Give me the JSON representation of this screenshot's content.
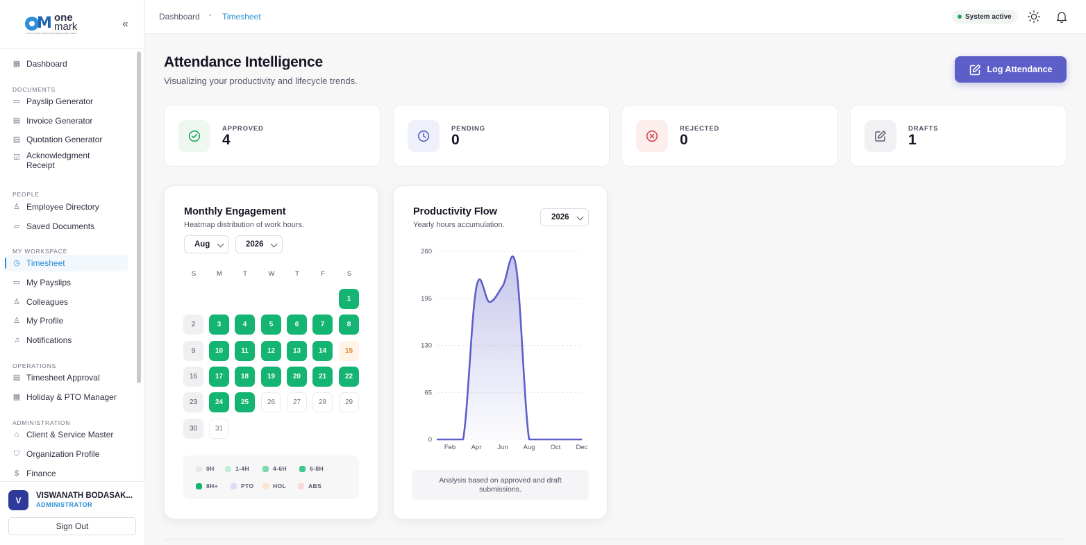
{
  "brand": {
    "name_top": "one",
    "name_bottom": "mark",
    "tagline": "A unit of Amarg Creative Technologies Private Limited"
  },
  "nav": {
    "collapse_label": "«",
    "items": [
      {
        "label": "Dashboard",
        "icon": "grid-icon"
      },
      {
        "section": "DOCUMENTS"
      },
      {
        "label": "Payslip Generator",
        "icon": "card-icon"
      },
      {
        "label": "Invoice Generator",
        "icon": "document-icon"
      },
      {
        "label": "Quotation Generator",
        "icon": "document-icon"
      },
      {
        "label": "Acknowledgment Receipt",
        "icon": "check-square-icon"
      },
      {
        "section": "PEOPLE"
      },
      {
        "label": "Employee Directory",
        "icon": "users-icon"
      },
      {
        "label": "Saved Documents",
        "icon": "folder-icon"
      },
      {
        "section": "MY WORKSPACE"
      },
      {
        "label": "Timesheet",
        "icon": "clock-icon",
        "active": true
      },
      {
        "label": "My Payslips",
        "icon": "card-icon"
      },
      {
        "label": "Colleagues",
        "icon": "users-icon"
      },
      {
        "label": "My Profile",
        "icon": "user-icon"
      },
      {
        "label": "Notifications",
        "icon": "bell-icon"
      },
      {
        "section": "OPERATIONS"
      },
      {
        "label": "Timesheet Approval",
        "icon": "document-icon"
      },
      {
        "label": "Holiday & PTO Manager",
        "icon": "calendar-icon"
      },
      {
        "section": "ADMINISTRATION"
      },
      {
        "label": "Client & Service Master",
        "icon": "home-icon"
      },
      {
        "label": "Organization Profile",
        "icon": "shield-icon"
      },
      {
        "label": "Finance",
        "icon": "dollar-icon"
      }
    ]
  },
  "user": {
    "initial": "V",
    "name": "VISWANATH BODASAK...",
    "role": "ADMINISTRATOR",
    "signout_label": "Sign Out"
  },
  "header": {
    "breadcrumb_root": "Dashboard",
    "breadcrumb_current": "Timesheet",
    "status": "System active"
  },
  "page": {
    "title": "Attendance Intelligence",
    "subtitle": "Visualizing your productivity and lifecycle trends.",
    "log_button": "Log Attendance"
  },
  "stats": [
    {
      "label": "APPROVED",
      "value": "4",
      "color": "#1fa463",
      "bg": "#eef8f1",
      "icon": "check-circle-icon"
    },
    {
      "label": "PENDING",
      "value": "0",
      "color": "#5d5fc9",
      "bg": "#eef0fb",
      "icon": "clock-icon"
    },
    {
      "label": "REJECTED",
      "value": "0",
      "color": "#d94545",
      "bg": "#fdeeee",
      "icon": "x-circle-icon"
    },
    {
      "label": "DRAFTS",
      "value": "1",
      "color": "#55596b",
      "bg": "#f1f1f4",
      "icon": "edit-icon"
    }
  ],
  "engagement": {
    "title": "Monthly Engagement",
    "subtitle": "Heatmap distribution of work hours.",
    "month": "Aug",
    "year": "2026",
    "weekdays": [
      "S",
      "M",
      "T",
      "W",
      "T",
      "F",
      "S"
    ],
    "first_weekday": 6,
    "days": [
      {
        "d": "1",
        "s": "full"
      },
      {
        "d": "2",
        "s": "zero"
      },
      {
        "d": "3",
        "s": "full"
      },
      {
        "d": "4",
        "s": "full"
      },
      {
        "d": "5",
        "s": "full"
      },
      {
        "d": "6",
        "s": "full"
      },
      {
        "d": "7",
        "s": "full"
      },
      {
        "d": "8",
        "s": "full"
      },
      {
        "d": "9",
        "s": "zero"
      },
      {
        "d": "10",
        "s": "full"
      },
      {
        "d": "11",
        "s": "full"
      },
      {
        "d": "12",
        "s": "full"
      },
      {
        "d": "13",
        "s": "full"
      },
      {
        "d": "14",
        "s": "full"
      },
      {
        "d": "15",
        "s": "hol"
      },
      {
        "d": "16",
        "s": "zero"
      },
      {
        "d": "17",
        "s": "full"
      },
      {
        "d": "18",
        "s": "full"
      },
      {
        "d": "19",
        "s": "full"
      },
      {
        "d": "20",
        "s": "full"
      },
      {
        "d": "21",
        "s": "full"
      },
      {
        "d": "22",
        "s": "full"
      },
      {
        "d": "23",
        "s": "zero"
      },
      {
        "d": "24",
        "s": "full"
      },
      {
        "d": "25",
        "s": "full"
      },
      {
        "d": "26",
        "s": "empty"
      },
      {
        "d": "27",
        "s": "empty"
      },
      {
        "d": "28",
        "s": "empty"
      },
      {
        "d": "29",
        "s": "empty"
      },
      {
        "d": "30",
        "s": "zero"
      },
      {
        "d": "31",
        "s": "empty"
      }
    ],
    "legend": [
      {
        "label": "0H",
        "color": "#e8e8eb"
      },
      {
        "label": "1-4H",
        "color": "#c5ecd8"
      },
      {
        "label": "4-6H",
        "color": "#7fd9ac"
      },
      {
        "label": "6-8H",
        "color": "#3ec98a"
      },
      {
        "label": "8H+",
        "color": "#14b472"
      },
      {
        "label": "PTO",
        "color": "#dcdcf7"
      },
      {
        "label": "HOL",
        "color": "#fde3cb"
      },
      {
        "label": "ABS",
        "color": "#fbdada"
      }
    ]
  },
  "productivity": {
    "title": "Productivity Flow",
    "subtitle": "Yearly hours accumulation.",
    "year": "2026",
    "note": "Analysis based on approved and draft submissions."
  },
  "chart_data": {
    "type": "area",
    "x": [
      "Jan",
      "Feb",
      "Mar",
      "Apr",
      "May",
      "Jun",
      "Jul",
      "Aug",
      "Sep",
      "Oct",
      "Nov",
      "Dec"
    ],
    "x_tick_labels": [
      "Feb",
      "Apr",
      "Jun",
      "Aug",
      "Oct",
      "Dec"
    ],
    "series": [
      {
        "values": [
          0,
          0,
          0,
          210,
          190,
          212,
          240,
          0,
          0,
          0,
          0,
          0
        ],
        "color": "#5d5fc9"
      }
    ],
    "y_ticks": [
      0,
      65,
      130,
      195,
      260
    ],
    "ylim": [
      0,
      260
    ],
    "grid": true
  }
}
